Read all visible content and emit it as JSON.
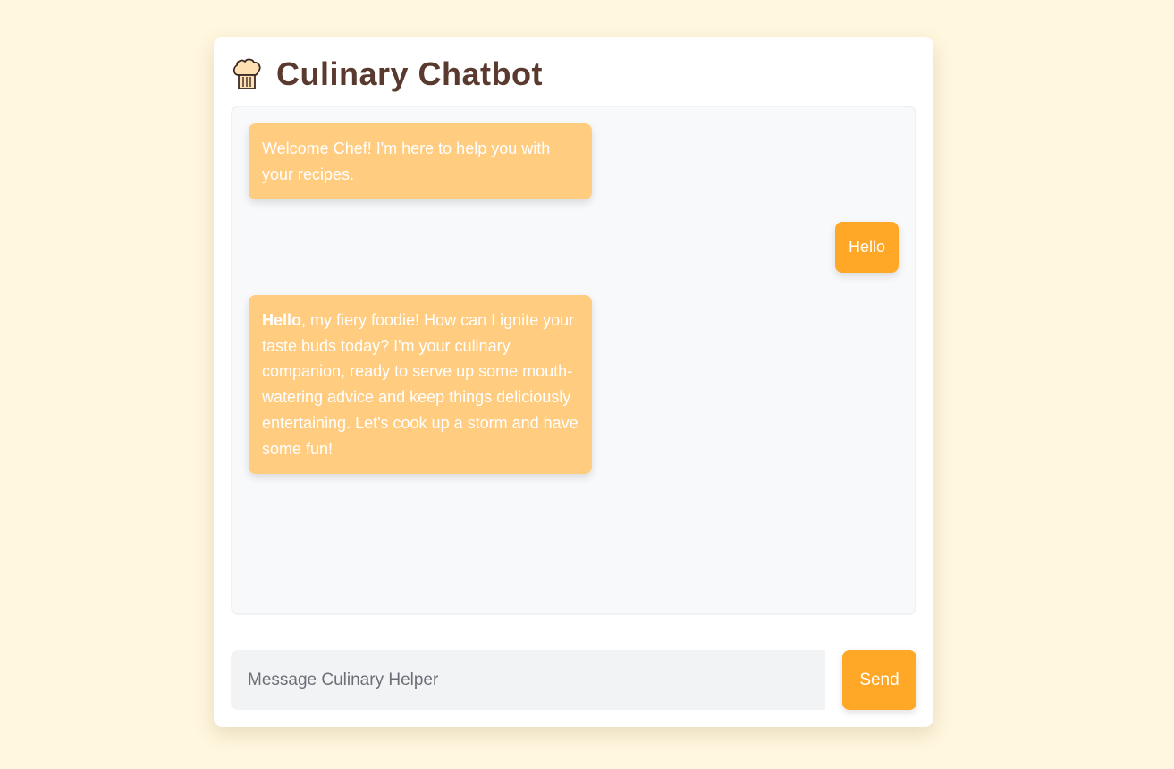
{
  "app": {
    "title": "Culinary Chatbot",
    "icon": "chef-hat-icon"
  },
  "messages": [
    {
      "role": "bot",
      "text": "Welcome Chef! I'm here to help you with your recipes."
    },
    {
      "role": "user",
      "text": "Hello"
    },
    {
      "role": "bot",
      "bold": "Hello",
      "text": ", my fiery foodie! How can I ignite your taste buds today? I'm your culinary companion, ready to serve up some mouth-watering advice and keep things deliciously entertaining. Let's cook up a storm and have some fun!"
    }
  ],
  "composer": {
    "placeholder": "Message Culinary Helper",
    "value": "",
    "send_label": "Send"
  },
  "colors": {
    "background": "#fff7df",
    "title": "#5a3a2e",
    "bot_bubble": "#ffcc80",
    "user_bubble": "#ffa726",
    "send_button": "#ffa726"
  }
}
